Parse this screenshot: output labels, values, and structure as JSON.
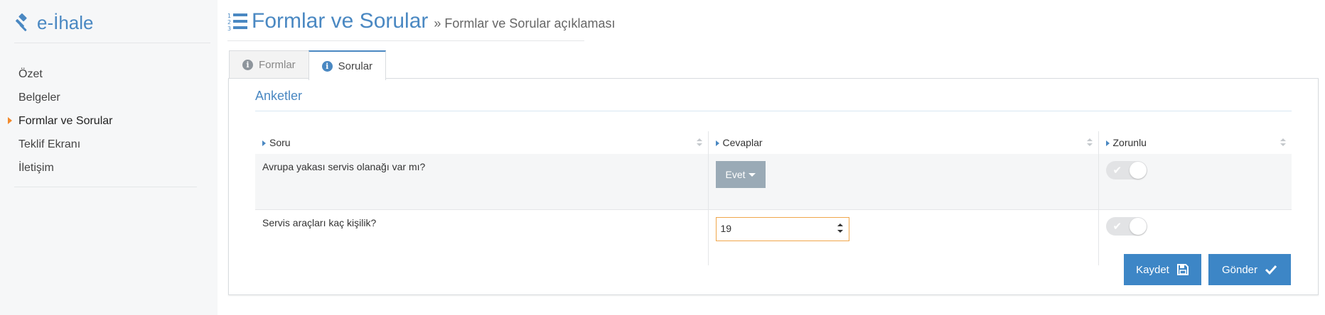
{
  "brand": {
    "title": "e-İhale",
    "icon": "gavel-icon"
  },
  "sidebar": {
    "items": [
      {
        "label": "Özet",
        "active": false
      },
      {
        "label": "Belgeler",
        "active": false
      },
      {
        "label": "Formlar ve Sorular",
        "active": true
      },
      {
        "label": "Teklif Ekranı",
        "active": false
      },
      {
        "label": "İletişim",
        "active": false
      }
    ]
  },
  "header": {
    "title": "Formlar ve Sorular",
    "subtitle": "» Formlar ve Sorular açıklaması",
    "icon": "ordered-list-icon"
  },
  "tabs": [
    {
      "label": "Formlar",
      "active": false,
      "icon": "info-icon"
    },
    {
      "label": "Sorular",
      "active": true,
      "icon": "info-icon"
    }
  ],
  "section": {
    "title": "Anketler"
  },
  "table": {
    "columns": [
      "Soru",
      "Cevaplar",
      "Zorunlu"
    ],
    "rows": [
      {
        "question": "Avrupa yakası servis olanağı var mı?",
        "answer_type": "dropdown",
        "answer": "Evet",
        "required": true
      },
      {
        "question": "Servis araçları kaç kişilik?",
        "answer_type": "number",
        "answer": "19",
        "required": true
      }
    ]
  },
  "buttons": {
    "save_label": "Kaydet",
    "send_label": "Gönder"
  },
  "colors": {
    "accent": "#4a88c2",
    "button": "#3d86c6",
    "active_marker": "#f28a2d",
    "input_focus": "#f0a64b"
  }
}
